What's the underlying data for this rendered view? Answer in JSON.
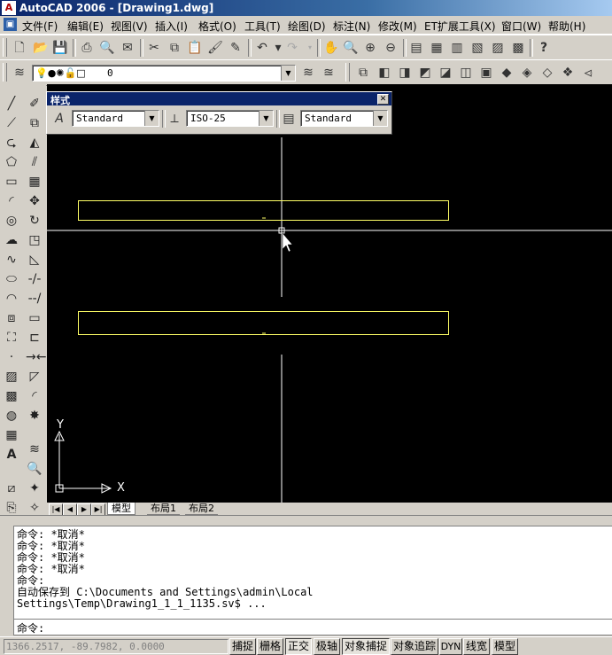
{
  "window": {
    "title": "AutoCAD 2006 - [Drawing1.dwg]",
    "app_icon": "autocad-icon"
  },
  "menu": [
    "文件(F)",
    "编辑(E)",
    "视图(V)",
    "插入(I)",
    "格式(O)",
    "工具(T)",
    "绘图(D)",
    "标注(N)",
    "修改(M)",
    "ET扩展工具(X)",
    "窗口(W)",
    "帮助(H)"
  ],
  "layer": {
    "current": "0"
  },
  "styles_toolbar": {
    "title": "样式",
    "text_style": "Standard",
    "dim_style": "ISO-25",
    "table_style": "Standard"
  },
  "ucs": {
    "x_label": "X",
    "y_label": "Y"
  },
  "tabs": [
    "模型",
    "布局1",
    "布局2"
  ],
  "active_tab": "模型",
  "command_history": [
    "命令: *取消*",
    "命令: *取消*",
    "命令: *取消*",
    "命令: *取消*",
    "命令:",
    "自动保存到 C:\\Documents and Settings\\admin\\Local",
    "Settings\\Temp\\Drawing1_1_1_1135.sv$ ..."
  ],
  "command_prompt": "命令:",
  "status": {
    "coords": "1366.2517, -89.7982, 0.0000",
    "buttons": [
      "捕捉",
      "栅格",
      "正交",
      "极轴",
      "对象捕捉",
      "对象追踪",
      "DYN",
      "线宽",
      "模型"
    ]
  },
  "colors": {
    "canvas": "#000000",
    "rect": "#ffff66",
    "crosshair": "#ffffff"
  }
}
